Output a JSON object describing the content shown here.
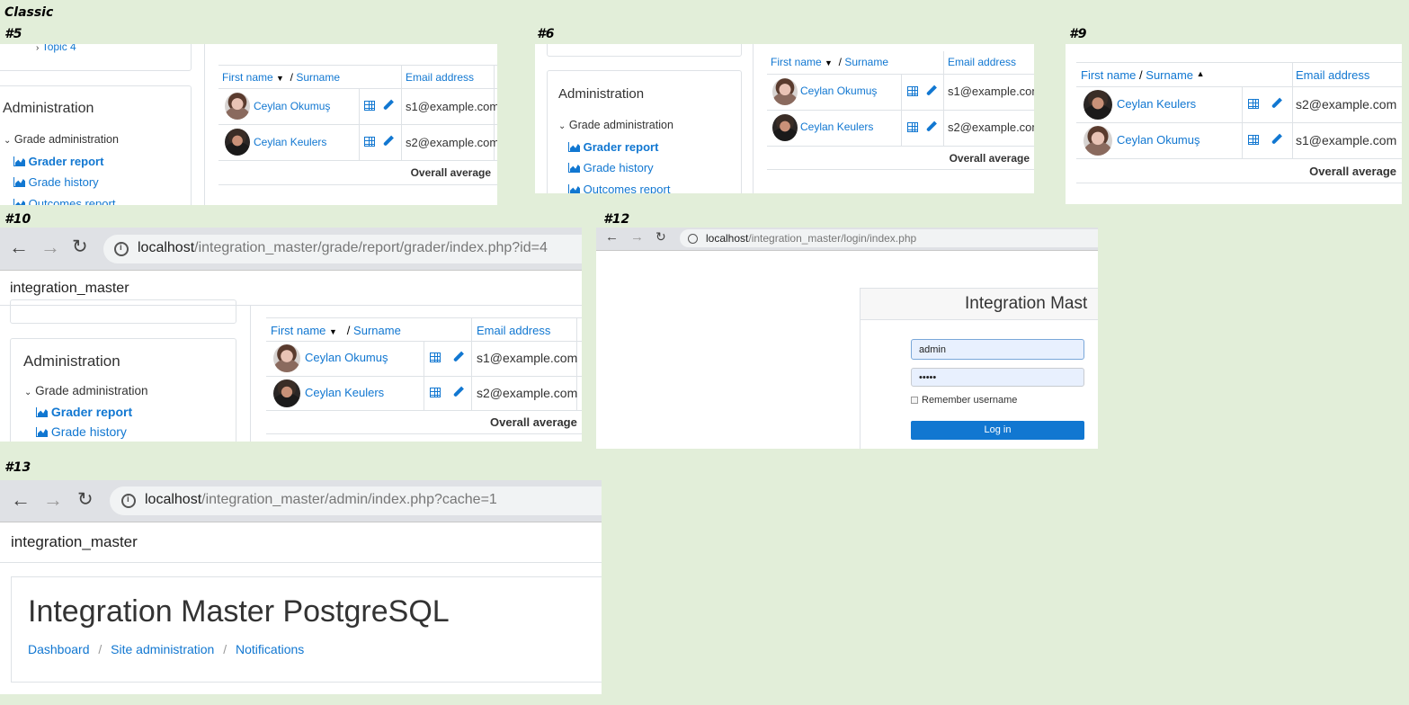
{
  "labels": {
    "classic": "Classic",
    "s5": "#5",
    "s6": "#6",
    "s9": "#9",
    "s10": "#10",
    "s12": "#12",
    "s13": "#13"
  },
  "grader": {
    "topic": "Topic 4",
    "admin_title": "Administration",
    "grade_admin": "Grade administration",
    "grader_report": "Grader report",
    "grade_history": "Grade history",
    "outcomes_report": "Outcomes report",
    "col_firstname": "First name",
    "col_separator": "/",
    "col_surname": "Surname",
    "col_email": "Email address",
    "overall": "Overall average",
    "rows": [
      {
        "name": "Ceylan Okumuş",
        "email": "s1@example.com"
      },
      {
        "name": "Ceylan Keulers",
        "email": "s2@example.com"
      }
    ],
    "rows_sorted": [
      {
        "name": "Ceylan Keulers",
        "email": "s2@example.com"
      },
      {
        "name": "Ceylan Okumuş",
        "email": "s1@example.com"
      }
    ]
  },
  "browser10": {
    "host": "localhost",
    "path": "/integration_master/grade/report/grader/index.php?id=4",
    "site": "integration_master"
  },
  "login12": {
    "host": "localhost",
    "path": "/integration_master/login/index.php",
    "heading": "Integration Mast",
    "username": "admin",
    "password": "•••••",
    "remember": "Remember username",
    "login_btn": "Log in"
  },
  "browser13": {
    "host": "localhost",
    "path": "/integration_master/admin/index.php?cache=1",
    "site": "integration_master",
    "heading": "Integration Master PostgreSQL",
    "crumbs": [
      "Dashboard",
      "Site administration",
      "Notifications"
    ],
    "crumb_sep": "/"
  },
  "colors": {
    "link": "#1177d1",
    "bg": "#e2eed9",
    "button": "#1177d1"
  }
}
